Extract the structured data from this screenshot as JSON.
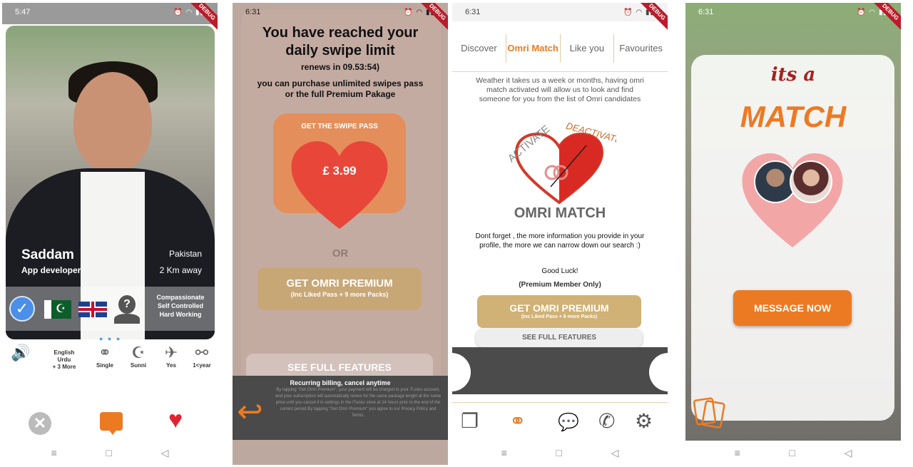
{
  "phone1": {
    "time": "5:47",
    "debug": "DEBUG",
    "name": "Saddam",
    "job": "App developer",
    "country": "Pakistan",
    "distance": "2 Km away",
    "personality": "Compassionate\nSelf Controlled\nHard Working",
    "attrs": [
      {
        "icon": "voice-icon",
        "glyph": "🔊",
        "label": ""
      },
      {
        "icon": "languages",
        "glyph": "",
        "label": "English\nUrdu\n+ 3 More"
      },
      {
        "icon": "rings-icon",
        "glyph": "⚭",
        "label": "Single"
      },
      {
        "icon": "crescent-icon",
        "glyph": "☪",
        "label": "Sunni"
      },
      {
        "icon": "plane-icon",
        "glyph": "✈",
        "label": "Yes"
      },
      {
        "icon": "ring-icon",
        "glyph": "💍",
        "label": "1<year"
      }
    ]
  },
  "phone2": {
    "time": "6:31",
    "debug": "DEBUG",
    "title": "You have reached your daily swipe limit",
    "renews": "renews in 09.53:54)",
    "purchase": "you can purchase unlimited swipes pass or the full Premium Pakage",
    "ticket_label": "GET THE  SWIPE PASS",
    "price": "£ 3.99",
    "or": "OR",
    "premium_label": "GET OMRI PREMIUM",
    "premium_sub": "(Inc Liked Pass + 9 more Packs)",
    "features_label": "SEE FULL FEATURES",
    "recurring": "Recurring billing, cancel anytime",
    "terms": "By tapping \"Get Omri Premium\", your payment will be charged to your iTunes account, and your subscription will automatically renew for the same package lenght at the same price until you cancel it in settings in the iTunes store at 24 hours prior to the end of the current period.By tapping \"Get Omri Premium\" you agree to our Privacy Policy and Terms."
  },
  "phone3": {
    "time": "6:31",
    "debug": "DEBUG",
    "tabs": [
      "Discover",
      "Omri Match",
      "Like you",
      "Favourites"
    ],
    "desc": "Weather it takes us a week or months, having omri match activated will allow us to look and find someone for you from the list of Omri candidates",
    "logo_activate": "ACTIVATE",
    "logo_deactivate": "DEACTIVATE",
    "title": "OMRI MATCH",
    "info": "Dont forget , the more information you provide in your profile, the more we can narrow down our search :)",
    "luck": "Good Luck!",
    "premium_only": "(Premium Member Only)",
    "premium_label": "GET OMRI PREMIUM",
    "premium_sub": "(Inc Liked Pass + 9 more Packs)",
    "features_label": "SEE FULL FEATURES"
  },
  "phone4": {
    "time": "6:31",
    "debug": "DEBUG",
    "its_a": "its a",
    "match": "MATCH",
    "message_label": "MESSAGE NOW"
  },
  "colors": {
    "accent": "#ec7a23",
    "heart": "#e0232e",
    "gold": "#c8a777",
    "dark": "#4a4a4a"
  }
}
